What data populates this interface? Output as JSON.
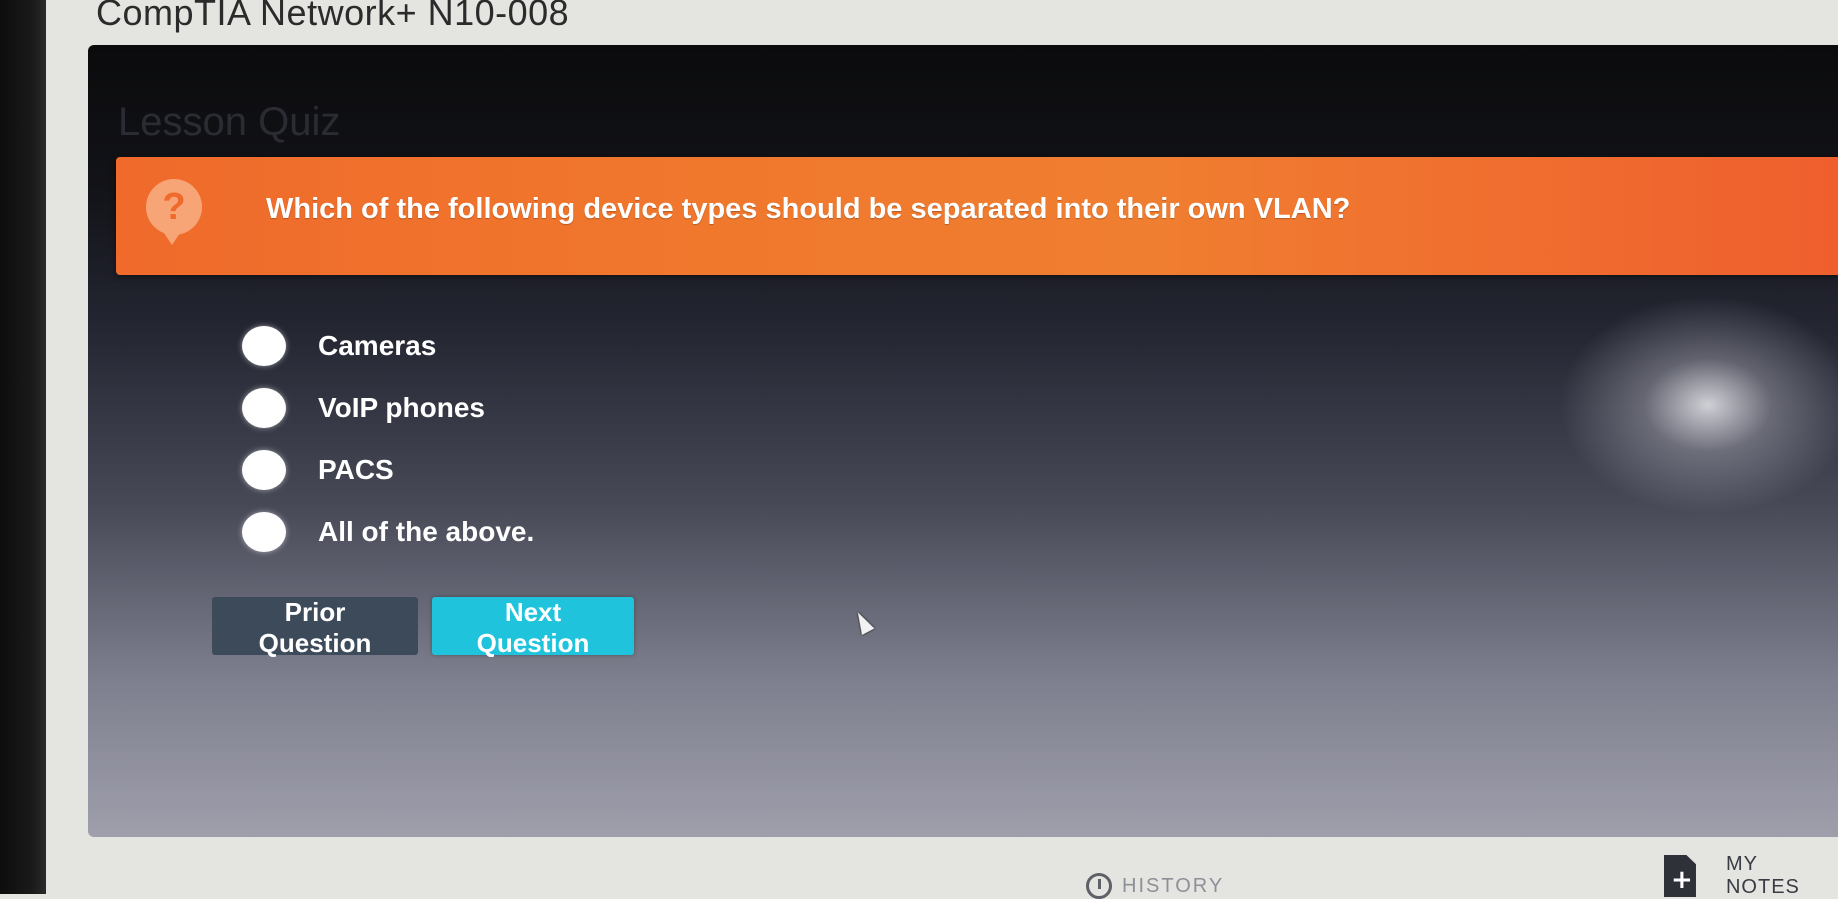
{
  "course": {
    "title": "CompTIA Network+ N10-008"
  },
  "quiz": {
    "heading": "Lesson Quiz",
    "question": "Which of the following device types should be separated into their own VLAN?",
    "question_icon": "?",
    "answers": [
      {
        "label": "Cameras"
      },
      {
        "label": "VoIP phones"
      },
      {
        "label": "PACS"
      },
      {
        "label": "All of the above."
      }
    ],
    "prior_label": "Prior Question",
    "next_label": "Next Question"
  },
  "footer": {
    "history_label": "HISTORY",
    "notes_label": "MY NOTES"
  },
  "colors": {
    "question_bar": "#ef6a2b",
    "next_button": "#1fc3dc",
    "prior_button": "#3d4a5a"
  },
  "icons": {
    "question": "question-bubble-icon",
    "history": "clock-icon",
    "notes": "note-add-icon",
    "cursor": "mouse-pointer-icon"
  }
}
